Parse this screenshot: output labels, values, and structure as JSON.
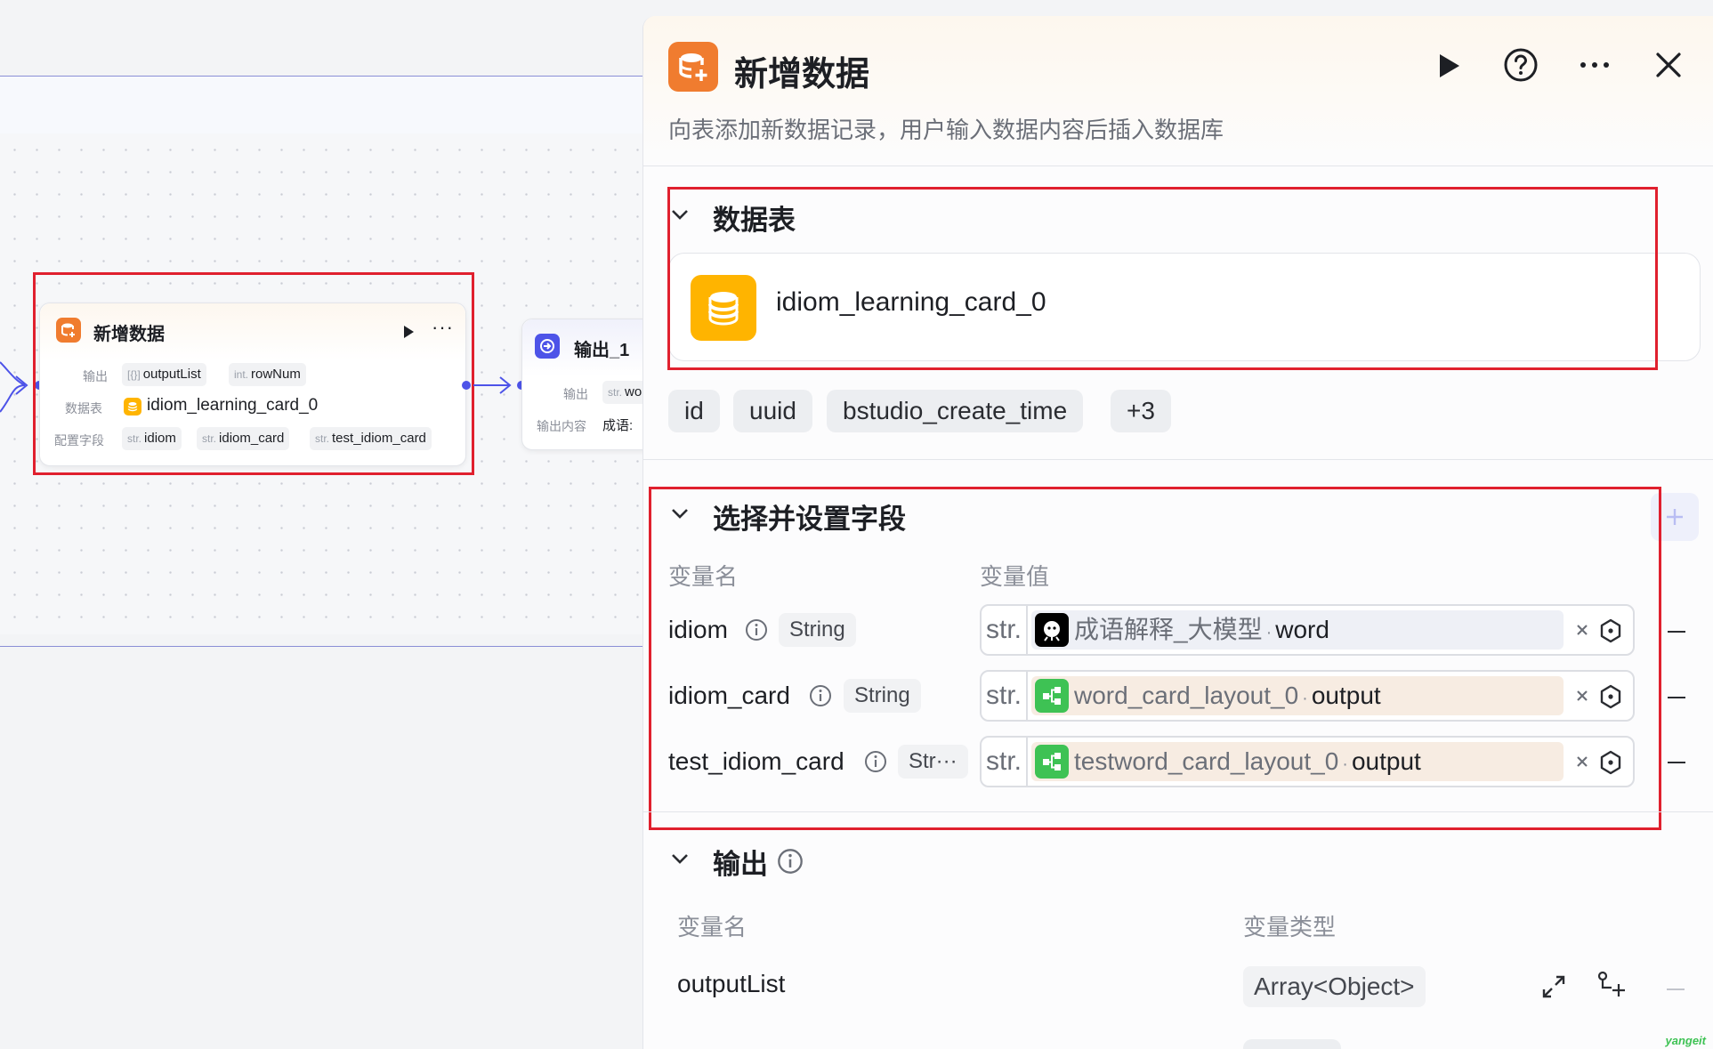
{
  "canvas": {
    "node_insert": {
      "title": "新增数据",
      "output_label": "输出",
      "output_tags": [
        {
          "prefix": "[{}]",
          "name": "outputList"
        },
        {
          "prefix": "int.",
          "name": "rowNum"
        }
      ],
      "table_label": "数据表",
      "table_name": "idiom_learning_card_0",
      "fields_label": "配置字段",
      "field_tags": [
        {
          "prefix": "str.",
          "name": "idiom"
        },
        {
          "prefix": "str.",
          "name": "idiom_card"
        },
        {
          "prefix": "str.",
          "name": "test_idiom_card"
        }
      ]
    },
    "node_output": {
      "title": "输出_1",
      "output_label": "输出",
      "output_tag_prefix": "str.",
      "output_tag_name": "wo",
      "content_label": "输出内容",
      "content_value": "成语:"
    }
  },
  "panel": {
    "title": "新增数据",
    "description": "向表添加新数据记录，用户输入数据内容后插入数据库",
    "table_section": {
      "title": "数据表",
      "table_name": "idiom_learning_card_0",
      "field_chips": [
        "id",
        "uuid",
        "bstudio_create_time",
        "+3"
      ]
    },
    "fields_section": {
      "title": "选择并设置字段",
      "col_name": "变量名",
      "col_value": "变量值",
      "rows": [
        {
          "name": "idiom",
          "type": "String",
          "prefix": "str.",
          "node": "成语解释_大模型",
          "port": "word",
          "icon": "llm-icon",
          "bg": "#eef0f6"
        },
        {
          "name": "idiom_card",
          "type": "String",
          "prefix": "str.",
          "node": "word_card_layout_0",
          "port": "output",
          "icon": "workflow-icon",
          "bg": "#f7ece2"
        },
        {
          "name": "test_idiom_card",
          "type": "Str···",
          "prefix": "str.",
          "node": "testword_card_layout_0",
          "port": "output",
          "icon": "workflow-icon",
          "bg": "#f7ece2"
        }
      ]
    },
    "output_section": {
      "title": "输出",
      "col_name": "变量名",
      "col_type": "变量类型",
      "rows": [
        {
          "name": "outputList",
          "type": "Array<Object>"
        }
      ]
    },
    "watermark": "yangeit"
  },
  "colors": {
    "accent": "#4d53e8",
    "highlight": "#e0202e",
    "db_orange": "#f07c2f",
    "table_yellow": "#ffb400",
    "workflow_green": "#3ec254"
  }
}
